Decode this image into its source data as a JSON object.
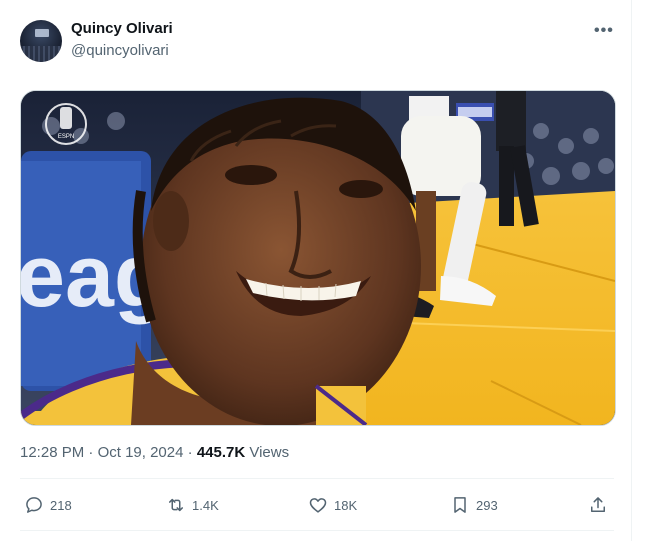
{
  "author": {
    "name": "Quincy Olivari",
    "handle": "@quincyolivari",
    "avatar_icon": "avatar-photo"
  },
  "menu_icon": "more-dots-icon",
  "media": {
    "kind": "photo",
    "overlay_text": "eagu",
    "logo_caption": "ESPN"
  },
  "meta": {
    "time": "12:28 PM",
    "sep1": " · ",
    "date": "Oct 19, 2024",
    "sep2": " · ",
    "views_count": "445.7K",
    "views_label": " Views"
  },
  "actions": {
    "replies": "218",
    "reposts": "1.4K",
    "likes": "18K",
    "bookmarks": "293"
  },
  "colors": {
    "text": "#0f1419",
    "muted": "#536471",
    "border": "#eff3f4"
  }
}
